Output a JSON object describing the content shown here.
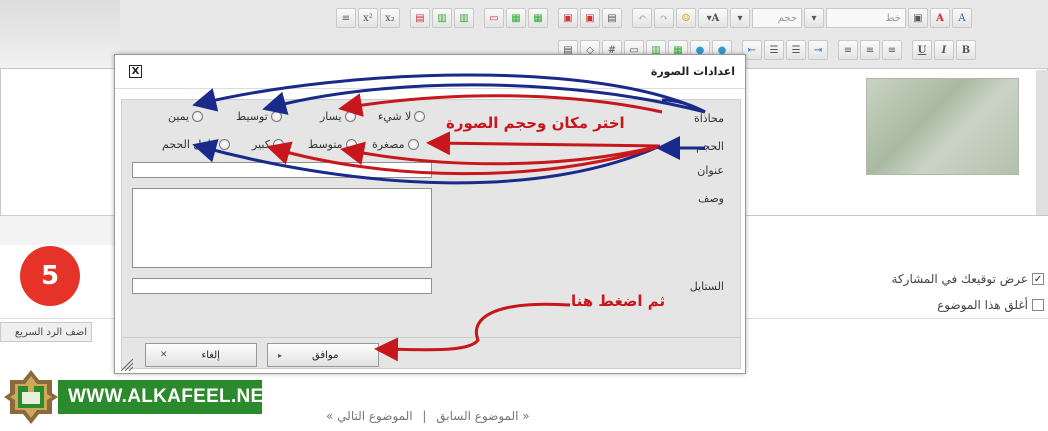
{
  "editor": {
    "toolbar_row1_icons": [
      "remove-format-icon",
      "superscript-icon",
      "subscript-icon",
      "insert-table-icon",
      "table-row-icon",
      "table-col-icon",
      "insert-hr-icon",
      "insert-image-icon",
      "insert-flash-icon",
      "paste-icon",
      "paste-text-icon",
      "paste-word-icon",
      "undo-icon",
      "redo-icon",
      "smiley-icon",
      "text-color-icon",
      "font-size-select",
      "font-select",
      "clean-icon",
      "strike-icon",
      "text-size-icon"
    ],
    "size_placeholder": "حجم",
    "font_placeholder": "خط",
    "toolbar_row2_icons": [
      "source-icon",
      "special-char-icon",
      "hash-icon",
      "quote-icon",
      "table-icon",
      "image-icon",
      "globe-icon",
      "link-icon",
      "indent-icon",
      "ordered-list-icon",
      "unordered-list-icon",
      "outdent-icon",
      "align-left-icon",
      "align-center-icon",
      "align-right-icon",
      "underline-icon",
      "italic-icon",
      "bold-icon"
    ],
    "bold": "B",
    "italic": "I",
    "underline": "U"
  },
  "dialog": {
    "title": "اعدادات الصورة",
    "close": "X",
    "align_label": "محاذاة",
    "size_label": "الحجم",
    "title_label": "عنوان",
    "desc_label": "وصف",
    "style_label": "الستايل",
    "align_options": [
      "لا شيء",
      "يسار",
      "توسيط",
      "يمين"
    ],
    "size_options": [
      "مصغرة",
      "متوسط",
      "كبير",
      "كامل الحجم"
    ],
    "ok": "موافق",
    "cancel": "إلغاء"
  },
  "annotations": {
    "choose": "اختر مكان وحجم الصورة",
    "then_press": "ثم اضغط هنا",
    "step": "5"
  },
  "options": {
    "signature": "عرض توقيعك في المشاركة",
    "signature_checked": true,
    "close_topic": "أغلق هذا الموضوع",
    "close_topic_checked": false
  },
  "quick_reply": "اضف الرد السريع",
  "footer": {
    "prev": "« الموضوع السابق",
    "sep": "|",
    "next": "الموضوع التالي »"
  },
  "logo": {
    "text": "WWW.ALKAFEEL.NET",
    "color": "#2b8a2b"
  },
  "colors": {
    "red_arrow": "#c8161d",
    "blue_arrow": "#1a2a8a"
  }
}
